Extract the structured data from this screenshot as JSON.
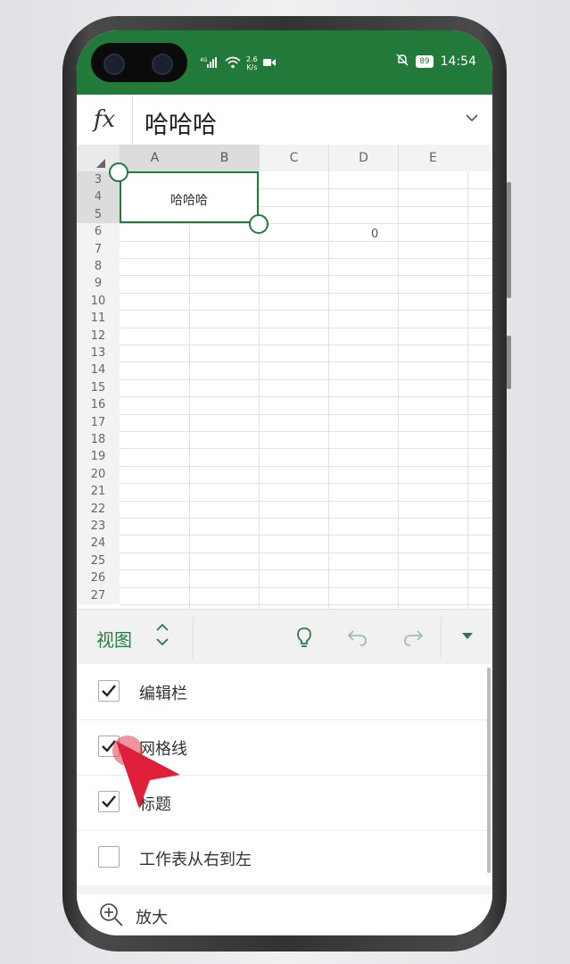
{
  "status_bar": {
    "net_speed_top": "2.6",
    "net_speed_bottom": "K/s",
    "battery": "89",
    "time": "14:54"
  },
  "formula_bar": {
    "fx_label": "fx",
    "value": "哈哈哈"
  },
  "sheet": {
    "columns": [
      "A",
      "B",
      "C",
      "D",
      "E"
    ],
    "rows": [
      "3",
      "4",
      "5",
      "6",
      "7",
      "8",
      "9",
      "10",
      "11",
      "12",
      "13",
      "14",
      "15",
      "16",
      "17",
      "18",
      "19",
      "20",
      "21",
      "22",
      "23",
      "24",
      "25",
      "26",
      "27"
    ],
    "selected_cell_text": "哈哈哈",
    "d6_value": "0"
  },
  "toolbar": {
    "tab_label": "视图"
  },
  "view_options": [
    {
      "label": "编辑栏",
      "checked": true
    },
    {
      "label": "网格线",
      "checked": true
    },
    {
      "label": "标题",
      "checked": true
    },
    {
      "label": "工作表从右到左",
      "checked": false
    }
  ],
  "zoom": {
    "label": "放大"
  },
  "colors": {
    "accent": "#227a3a",
    "tap_marker": "#e0203a"
  }
}
